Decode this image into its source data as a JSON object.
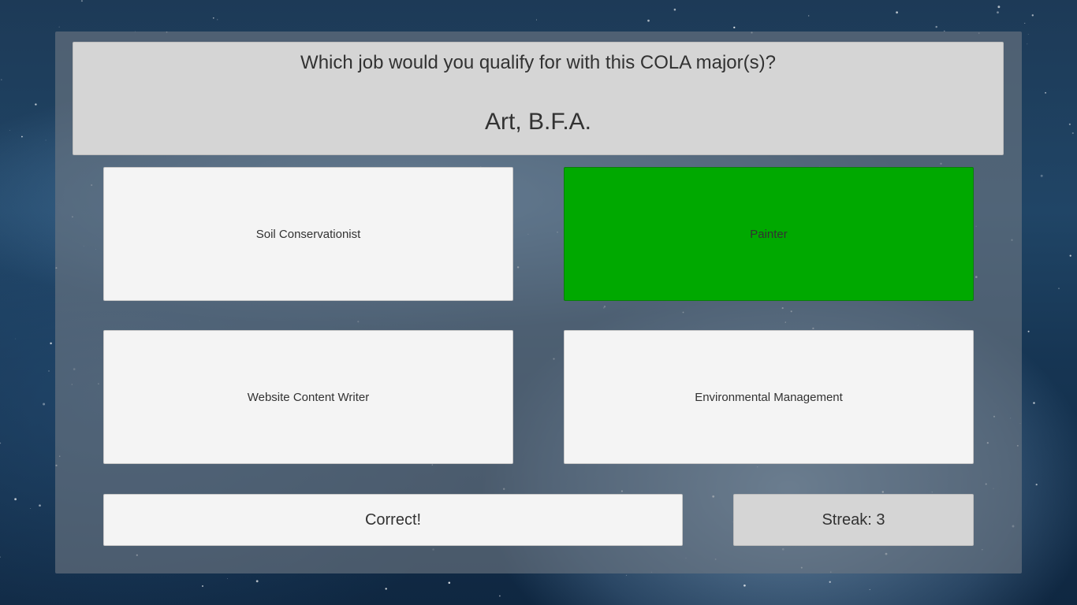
{
  "question": {
    "prompt": "Which job would you qualify for with this COLA major(s)?",
    "major": "Art, B.F.A."
  },
  "answers": [
    {
      "label": "Soil Conservationist",
      "state": "default"
    },
    {
      "label": "Painter",
      "state": "correct"
    },
    {
      "label": "Website Content Writer",
      "state": "default"
    },
    {
      "label": "Environmental Management",
      "state": "default"
    }
  ],
  "feedback": "Correct!",
  "streak_label": "Streak: 3",
  "colors": {
    "correct": "#00a900",
    "button": "#f4f4f4",
    "header": "#d5d5d5",
    "text": "#323232"
  }
}
